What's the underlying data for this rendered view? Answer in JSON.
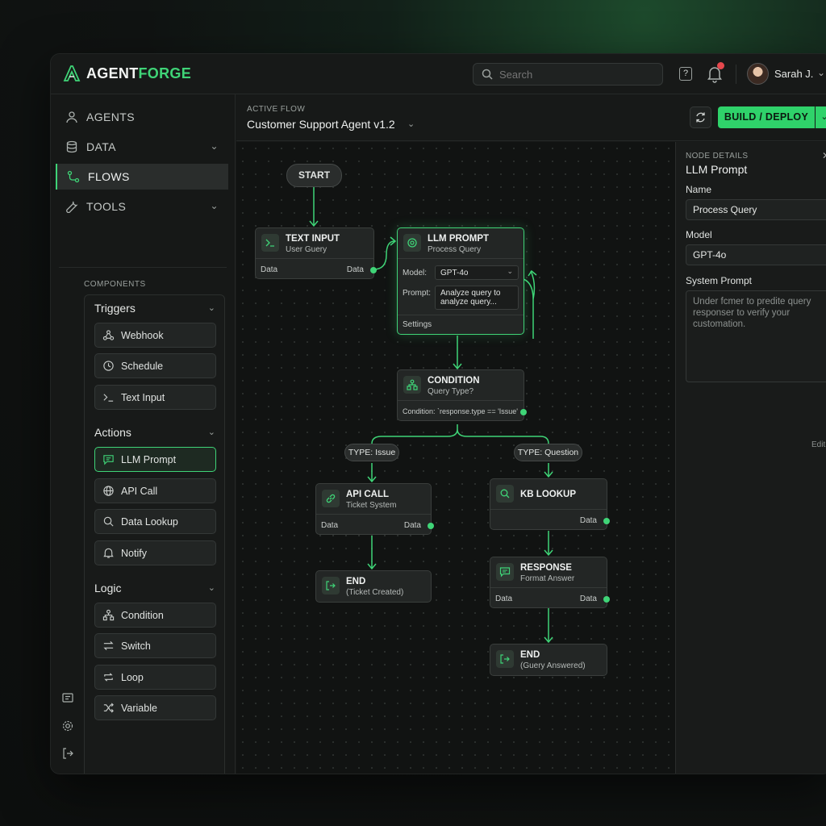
{
  "app": {
    "logo_a": "AGENT",
    "logo_b": "FORGE"
  },
  "header": {
    "search_placeholder": "Search",
    "help": "?",
    "user_name": "Sarah J."
  },
  "nav": {
    "agents": "AGENTS",
    "data": "DATA",
    "flows": "FLOWS",
    "tools": "TOOLS"
  },
  "components": {
    "label": "COMPONENTS",
    "triggers": {
      "title": "Triggers",
      "items": [
        "Webhook",
        "Schedule",
        "Text Input"
      ]
    },
    "actions": {
      "title": "Actions",
      "items": [
        "LLM Prompt",
        "API Call",
        "Data Lookup",
        "Notify"
      ]
    },
    "logic": {
      "title": "Logic",
      "items": [
        "Condition",
        "Switch",
        "Loop",
        "Variable"
      ]
    }
  },
  "flow": {
    "label": "ACTIVE FLOW",
    "title": "Customer Support Agent v1.2",
    "deploy": "BUILD / DEPLOY"
  },
  "canvas": {
    "start": "START",
    "text_input": {
      "title": "TEXT INPUT",
      "sub": "User Guery",
      "in": "Data",
      "out": "Data"
    },
    "llm": {
      "title": "LLM PROMPT",
      "sub": "Process Query",
      "model_lbl": "Model:",
      "model": "GPT-4o",
      "prompt_lbl": "Prompt:",
      "prompt": "Analyze query to analyze query...",
      "settings": "Settings"
    },
    "condition": {
      "title": "CONDITION",
      "sub": "Query Type?",
      "expr": "Condition: `response.type == 'Issue'"
    },
    "pill_issue": "TYPE: Issue",
    "pill_question": "TYPE: Question",
    "api": {
      "title": "API CALL",
      "sub": "Ticket System",
      "in": "Data",
      "out": "Data"
    },
    "kb": {
      "title": "KB LOOKUP",
      "out": "Data"
    },
    "response": {
      "title": "RESPONSE",
      "sub": "Format Answer",
      "in": "Data",
      "out": "Data"
    },
    "end1": {
      "title": "END",
      "sub": "(Ticket Created)"
    },
    "end2": {
      "title": "END",
      "sub": "(Guery Answered)"
    }
  },
  "details": {
    "label": "NODE DETAILS",
    "title": "LLM Prompt",
    "name_lbl": "Name",
    "name_val": "Process Query",
    "model_lbl": "Model",
    "model_val": "GPT-4o",
    "sys_lbl": "System Prompt",
    "sys_val": "Under fcmer to predite query responser to verify your customation.",
    "edit": "Edit"
  },
  "colors": {
    "accent": "#3fd477",
    "danger": "#e5484d",
    "bg": "#161817"
  }
}
